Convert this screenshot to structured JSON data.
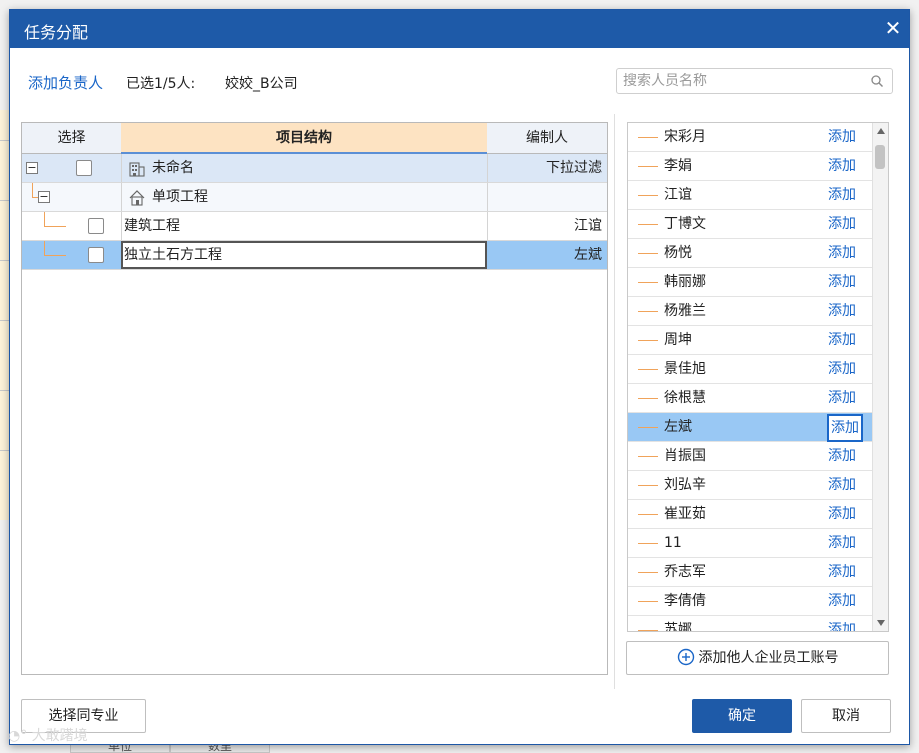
{
  "background": {
    "bottom_tabs": [
      "单位",
      "数里"
    ]
  },
  "dialog": {
    "title": "任务分配",
    "close_symbol": "✕",
    "add_owner_link": "添加负责人",
    "selected_label": "已选1/5人:",
    "selected_value": "姣姣_B公司",
    "search_placeholder": "搜索人员名称"
  },
  "grid": {
    "columns": [
      "选择",
      "项目结构",
      "编制人"
    ],
    "rows": [
      {
        "name": "未命名",
        "editor": "下拉过滤",
        "level": 0,
        "expander": "−",
        "has_checkbox": true,
        "icon": "building-icon"
      },
      {
        "name": "单项工程",
        "editor": "",
        "level": 1,
        "expander": "−",
        "has_checkbox": false,
        "icon": "house-icon"
      },
      {
        "name": "建筑工程",
        "editor": "江谊",
        "level": 2,
        "expander": "",
        "has_checkbox": true,
        "icon": ""
      },
      {
        "name": "独立土石方工程",
        "editor": "左斌",
        "level": 2,
        "expander": "",
        "has_checkbox": true,
        "icon": "",
        "selected": true
      }
    ]
  },
  "people": {
    "add_label": "添加",
    "items": [
      "宋彩月",
      "李娟",
      "江谊",
      "丁博文",
      "杨悦",
      "韩丽娜",
      "杨雅兰",
      "周坤",
      "景佳旭",
      "徐根慧",
      "左斌",
      "肖振国",
      "刘弘辛",
      "崔亚茹",
      "11",
      "乔志军",
      "李倩倩",
      "苏娜"
    ],
    "selected": "左斌",
    "add_other_button": "添加他人企业员工账号"
  },
  "footer": {
    "select_same_button": "选择同专业",
    "confirm_button": "确定",
    "cancel_button": "取消"
  },
  "watermark": "大敢躇境",
  "colors": {
    "title_bar": "#1e5aa8",
    "link": "#1a66c8",
    "selected_row": "#99c8f4",
    "header_highlight": "#fde3c2",
    "tree_line": "#f0a35a"
  }
}
